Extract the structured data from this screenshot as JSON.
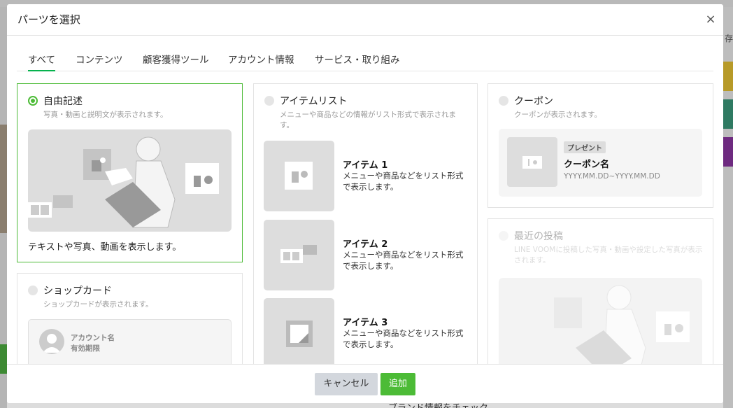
{
  "modal": {
    "title": "パーツを選択",
    "close_symbol": "×"
  },
  "tabs": [
    {
      "label": "すべて",
      "active": true
    },
    {
      "label": "コンテンツ",
      "active": false
    },
    {
      "label": "顧客獲得ツール",
      "active": false
    },
    {
      "label": "アカウント情報",
      "active": false
    },
    {
      "label": "サービス・取り組み",
      "active": false
    }
  ],
  "cards": {
    "free_text": {
      "title": "自由記述",
      "desc": "写真・動画と説明文が表示されます。",
      "caption": "テキストや写真、動画を表示します。",
      "selected": true
    },
    "shop_card": {
      "title": "ショップカード",
      "desc": "ショップカードが表示されます。",
      "account_name": "アカウント名",
      "expiry": "有効期限"
    },
    "item_list": {
      "title": "アイテムリスト",
      "desc": "メニューや商品などの情報がリスト形式で表示されます。",
      "items": [
        {
          "title": "アイテム 1",
          "desc": "メニューや商品などをリスト形式で表示します。"
        },
        {
          "title": "アイテム 2",
          "desc": "メニューや商品などをリスト形式で表示します。"
        },
        {
          "title": "アイテム 3",
          "desc": "メニューや商品などをリスト形式で表示します。"
        }
      ]
    },
    "coupon": {
      "title": "クーポン",
      "desc": "クーポンが表示されます。",
      "badge": "プレゼント",
      "name": "クーポン名",
      "date": "YYYY.MM.DD~YYYY.MM.DD"
    },
    "recent_posts": {
      "title": "最近の投稿",
      "desc": "LINE VOOMに投稿した写真・動画や設定した写真が表示されます。",
      "disabled": true
    }
  },
  "footer": {
    "cancel_label": "キャンセル",
    "add_label": "追加"
  },
  "background": {
    "right_text": "存",
    "bottom_text": "ブランド情報をチェック"
  },
  "colors": {
    "accent_green": "#4cbb36",
    "tab_underline": "#06b24d",
    "cancel_bg": "#d3d7dd"
  }
}
